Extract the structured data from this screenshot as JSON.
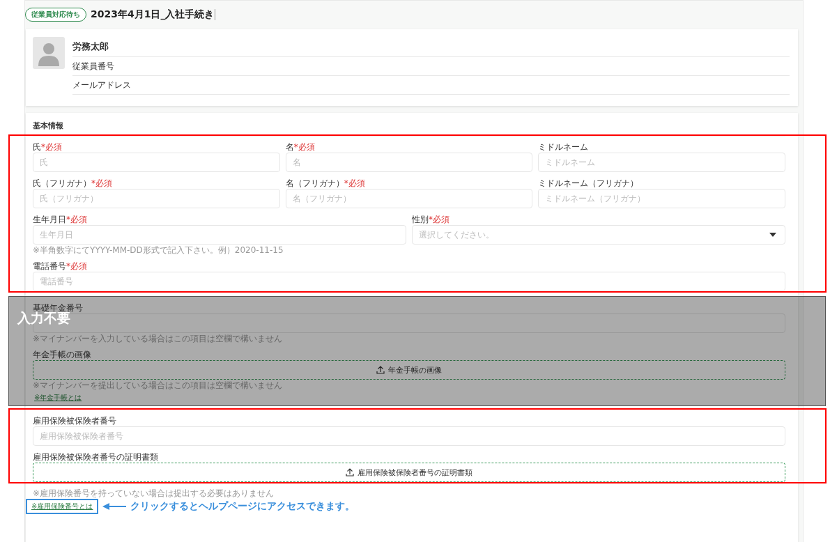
{
  "header": {
    "status_badge": "従業員対応待ち",
    "title": "2023年4月1日_入社手続き"
  },
  "profile": {
    "name": "労務太郎",
    "fields": [
      "従業員番号",
      "メールアドレス"
    ]
  },
  "section": {
    "title": "基本情報",
    "groups": [
      {
        "framed": true,
        "masked": false,
        "items": [
          {
            "kind": "row",
            "fields": [
              {
                "kind": "input",
                "label": "氏",
                "required": "*必須",
                "placeholder": "氏"
              },
              {
                "kind": "input",
                "label": "名",
                "required": "*必須",
                "placeholder": "名"
              },
              {
                "kind": "input",
                "label": "ミドルネーム",
                "placeholder": "ミドルネーム"
              }
            ]
          },
          {
            "kind": "row",
            "fields": [
              {
                "kind": "input",
                "label": "氏（フリガナ）",
                "required": "*必須",
                "placeholder": "氏（フリガナ）"
              },
              {
                "kind": "input",
                "label": "名（フリガナ）",
                "required": "*必須",
                "placeholder": "名（フリガナ）"
              },
              {
                "kind": "input",
                "label": "ミドルネーム（フリガナ）",
                "placeholder": "ミドルネーム（フリガナ）"
              }
            ]
          },
          {
            "kind": "row",
            "fields": [
              {
                "kind": "input",
                "label": "生年月日",
                "required": "*必須",
                "placeholder": "生年月日"
              },
              {
                "kind": "select",
                "label": "性別",
                "required": "*必須",
                "placeholder": "選択してください。"
              }
            ]
          },
          {
            "kind": "hint",
            "text": "※半角数字にてYYYY-MM-DD形式で記入下さい。例）2020-11-15"
          },
          {
            "kind": "row",
            "fields": [
              {
                "kind": "input",
                "label": "電話番号",
                "required": "*必須",
                "placeholder": "電話番号"
              }
            ]
          }
        ]
      },
      {
        "framed": false,
        "masked": true,
        "mask_label": "入力不要",
        "items": [
          {
            "kind": "row",
            "fields": [
              {
                "kind": "input",
                "label": "基礎年金番号"
              }
            ]
          },
          {
            "kind": "hint",
            "text": "※マイナンバーを入力している場合はこの項目は空欄で構いません"
          },
          {
            "kind": "row",
            "fields": [
              {
                "kind": "upload",
                "label": "年金手帳の画像",
                "button": "年金手帳の画像"
              }
            ]
          },
          {
            "kind": "hint",
            "text": "※マイナンバーを提出している場合はこの項目は空欄で構いません"
          },
          {
            "kind": "link",
            "text": "※年金手帳とは"
          }
        ]
      },
      {
        "framed": true,
        "masked": false,
        "items": [
          {
            "kind": "row",
            "fields": [
              {
                "kind": "input",
                "label": "雇用保険被保険者番号",
                "placeholder": "雇用保険被保険者番号"
              }
            ]
          },
          {
            "kind": "row",
            "fields": [
              {
                "kind": "upload",
                "label": "雇用保険被保険者番号の証明書類",
                "button": "雇用保険被保険者番号の証明書類"
              }
            ]
          }
        ]
      },
      {
        "framed": false,
        "masked": false,
        "items": [
          {
            "kind": "hint",
            "text": "※雇用保険番号を持っていない場合は提出する必要はありません"
          },
          {
            "kind": "link",
            "text": "※雇用保険番号とは",
            "callout": "クリックするとヘルプページにアクセスできます。"
          }
        ]
      }
    ]
  }
}
